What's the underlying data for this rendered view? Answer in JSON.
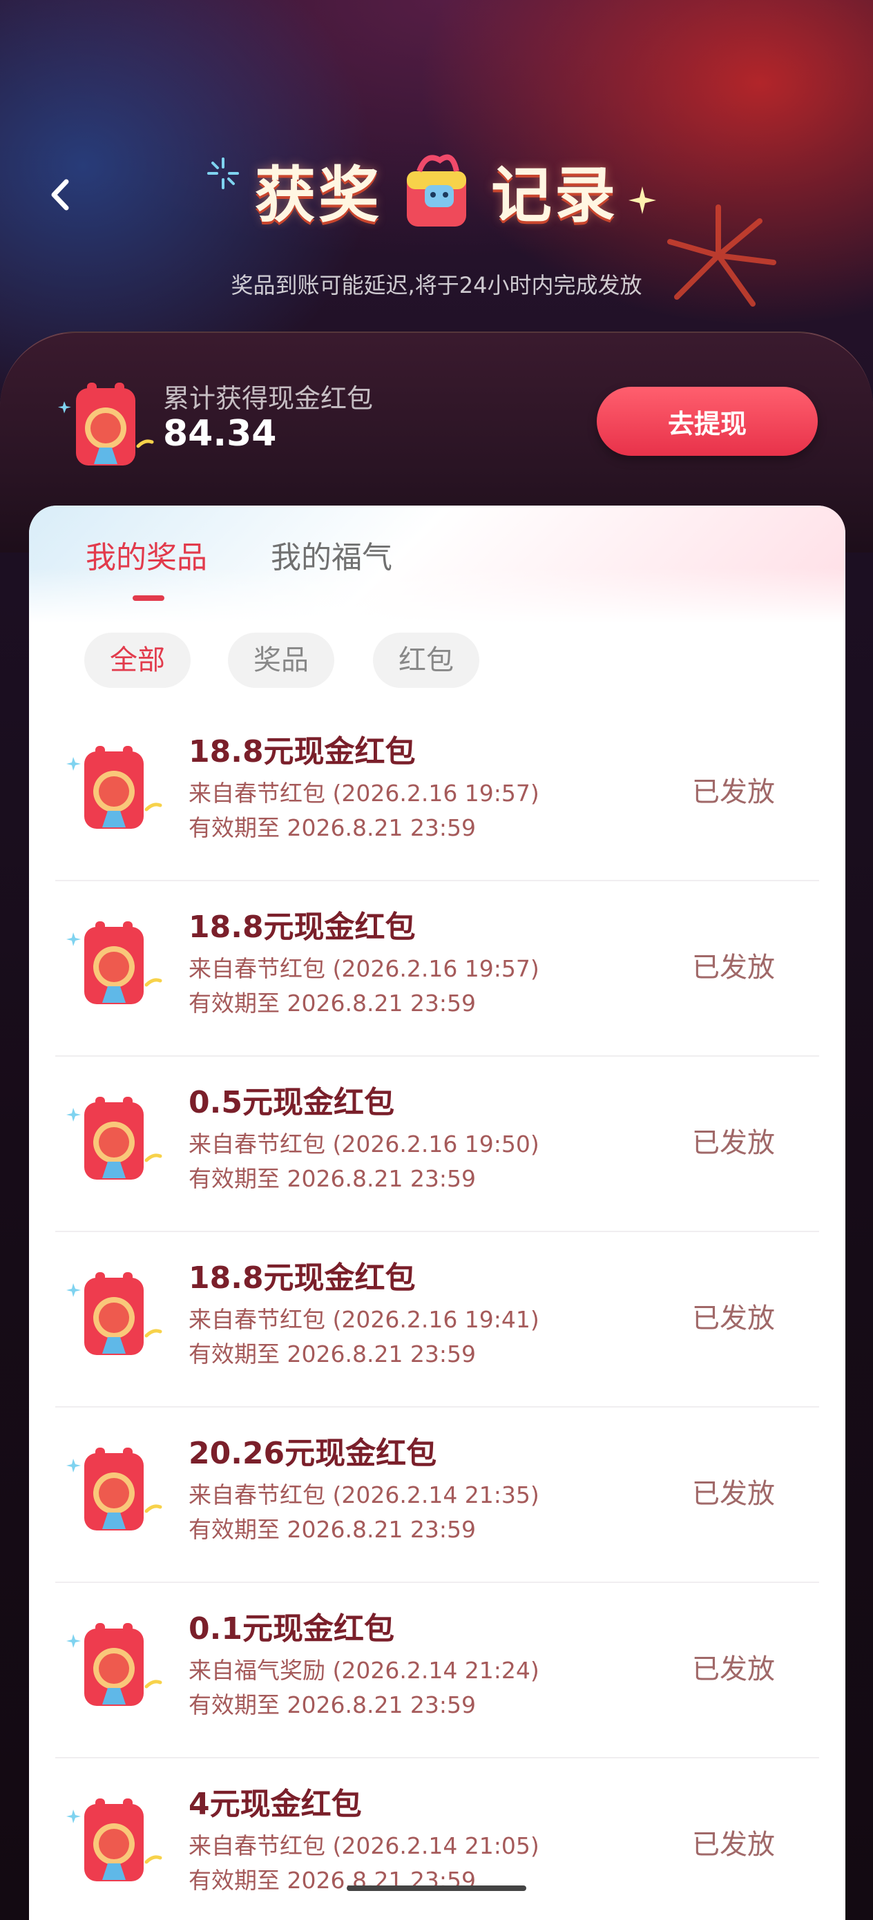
{
  "header": {
    "back_icon": "chevron-left-icon",
    "title_left": "获奖",
    "title_right": "记录",
    "title_icon": "gift-bag-icon",
    "subtitle": "奖品到账可能延迟,将于24小时内完成发放"
  },
  "summary": {
    "icon": "red-packet-icon",
    "label": "累计获得现金红包",
    "value": "84.34",
    "withdraw_label": "去提现"
  },
  "tabs": [
    {
      "label": "我的奖品",
      "active": true
    },
    {
      "label": "我的福气",
      "active": false
    }
  ],
  "filters": [
    {
      "label": "全部",
      "active": true
    },
    {
      "label": "奖品",
      "active": false
    },
    {
      "label": "红包",
      "active": false
    }
  ],
  "records": [
    {
      "title": "18.8元现金红包",
      "source": "来自春节红包 (2026.2.16 19:57)",
      "expiry": "有效期至 2026.8.21 23:59",
      "status": "已发放"
    },
    {
      "title": "18.8元现金红包",
      "source": "来自春节红包 (2026.2.16 19:57)",
      "expiry": "有效期至 2026.8.21 23:59",
      "status": "已发放"
    },
    {
      "title": "0.5元现金红包",
      "source": "来自春节红包 (2026.2.16 19:50)",
      "expiry": "有效期至 2026.8.21 23:59",
      "status": "已发放"
    },
    {
      "title": "18.8元现金红包",
      "source": "来自春节红包 (2026.2.16 19:41)",
      "expiry": "有效期至 2026.8.21 23:59",
      "status": "已发放"
    },
    {
      "title": "20.26元现金红包",
      "source": "来自春节红包 (2026.2.14 21:35)",
      "expiry": "有效期至 2026.8.21 23:59",
      "status": "已发放"
    },
    {
      "title": "0.1元现金红包",
      "source": "来自福气奖励 (2026.2.14 21:24)",
      "expiry": "有效期至 2026.8.21 23:59",
      "status": "已发放"
    },
    {
      "title": "4元现金红包",
      "source": "来自春节红包 (2026.2.14 21:05)",
      "expiry": "有效期至 2026.8.21 23:59",
      "status": "已发放"
    }
  ],
  "colors": {
    "accent": "#e23b4c",
    "title_text": "#7a1f2a",
    "meta_text": "#a55a5a"
  }
}
